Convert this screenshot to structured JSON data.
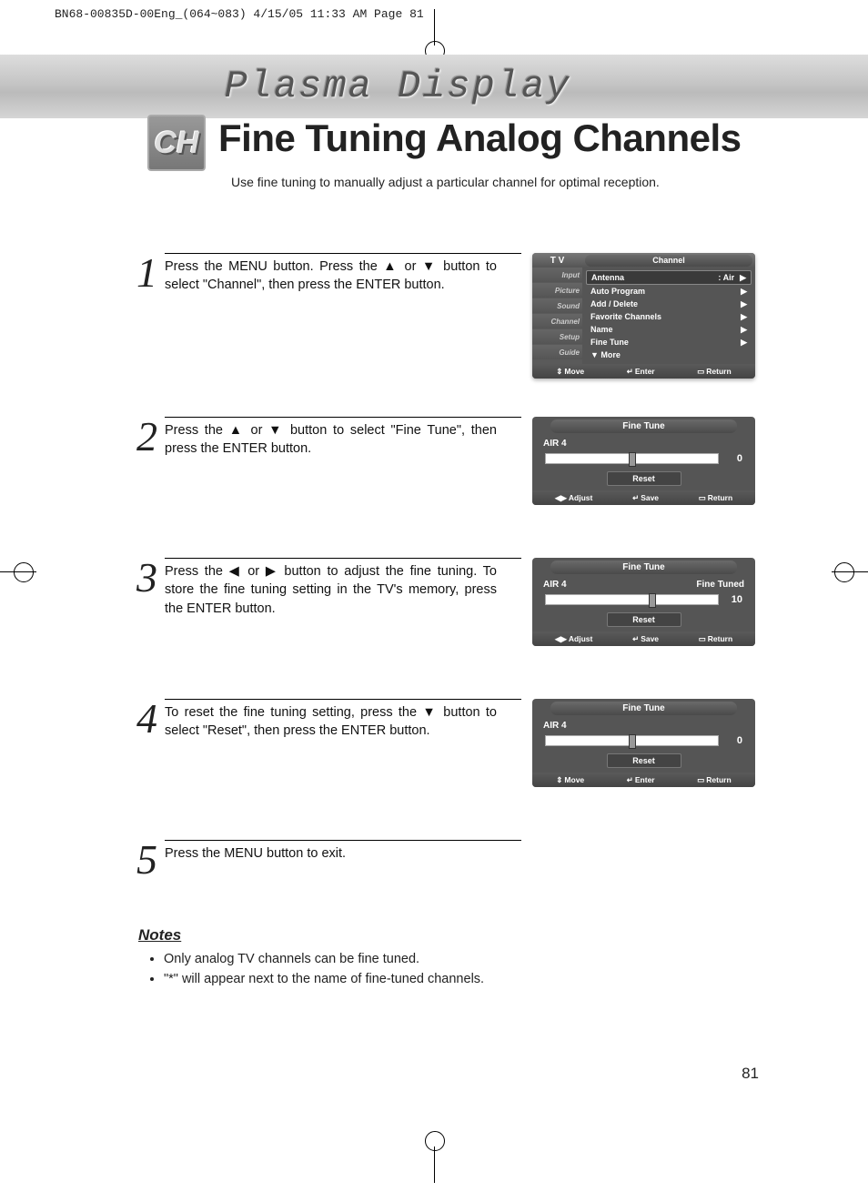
{
  "print_header": "BN68-00835D-00Eng_(064~083)  4/15/05  11:33 AM  Page 81",
  "banner_title": "Plasma Display",
  "badge": "CH",
  "page_title": "Fine Tuning Analog Channels",
  "page_subtitle": "Use fine tuning to manually adjust a particular channel for optimal reception.",
  "steps": [
    {
      "num": "1",
      "text": "Press the MENU button. Press the ▲ or ▼ button to select \"Channel\", then press the ENTER button."
    },
    {
      "num": "2",
      "text": "Press the ▲ or ▼ button to select \"Fine Tune\", then press the ENTER button."
    },
    {
      "num": "3",
      "text": "Press the ◀ or ▶ button to adjust the fine tuning. To store the fine tuning setting in the TV's memory, press the ENTER button."
    },
    {
      "num": "4",
      "text": "To reset the fine tuning setting, press the ▼ button to select \"Reset\", then press the ENTER button."
    },
    {
      "num": "5",
      "text": "Press the MENU button to exit."
    }
  ],
  "osd1": {
    "header_left": "T V",
    "header_right": "Channel",
    "tabs": [
      "Input",
      "Picture",
      "Sound",
      "Channel",
      "Setup",
      "Guide"
    ],
    "items": [
      {
        "label": "Antenna",
        "value": ": Air",
        "arrow": "▶",
        "sel": true
      },
      {
        "label": "Auto Program",
        "arrow": "▶"
      },
      {
        "label": "Add / Delete",
        "arrow": "▶"
      },
      {
        "label": "Favorite Channels",
        "arrow": "▶"
      },
      {
        "label": "Name",
        "arrow": "▶"
      },
      {
        "label": "Fine Tune",
        "arrow": "▶"
      },
      {
        "label": "▼ More"
      }
    ],
    "footer": [
      "Move",
      "Enter",
      "Return"
    ],
    "footer_icons": [
      "⇕",
      "↵",
      "▭"
    ]
  },
  "ft_screens": [
    {
      "title": "Fine Tune",
      "channel": "AIR  4",
      "status": "",
      "value": "0",
      "thumb": 48,
      "footer": [
        "Adjust",
        "Save",
        "Return"
      ],
      "ficons": [
        "◀▶",
        "↵",
        "▭"
      ]
    },
    {
      "title": "Fine Tune",
      "channel": "AIR  4",
      "status": "Fine Tuned",
      "value": "10",
      "thumb": 60,
      "footer": [
        "Adjust",
        "Save",
        "Return"
      ],
      "ficons": [
        "◀▶",
        "↵",
        "▭"
      ]
    },
    {
      "title": "Fine Tune",
      "channel": "AIR  4",
      "status": "",
      "value": "0",
      "thumb": 48,
      "footer": [
        "Move",
        "Enter",
        "Return"
      ],
      "ficons": [
        "⇕",
        "↵",
        "▭"
      ]
    }
  ],
  "reset_label": "Reset",
  "notes_title": "Notes",
  "notes": [
    "Only analog TV channels can be fine tuned.",
    "\"*\" will appear next to the name of fine-tuned channels."
  ],
  "page_number": "81"
}
